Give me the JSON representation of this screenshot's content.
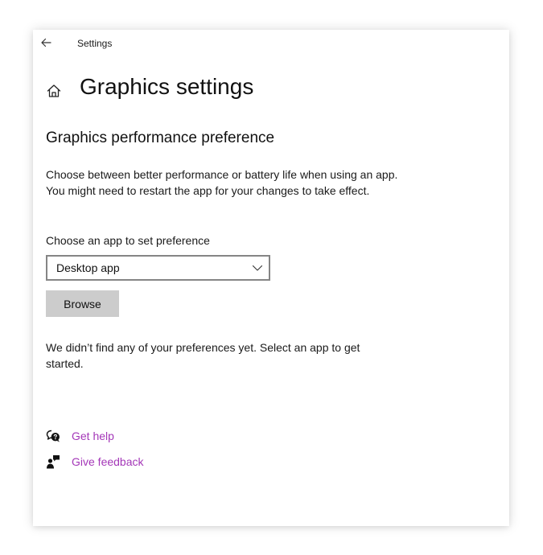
{
  "window": {
    "title": "Settings"
  },
  "header": {
    "page_title": "Graphics settings"
  },
  "section": {
    "title": "Graphics performance preference",
    "description": "Choose between better performance or battery life when using an app. You might need to restart the app for your changes to take effect."
  },
  "app_picker": {
    "label": "Choose an app to set preference",
    "selected": "Desktop app",
    "browse_label": "Browse"
  },
  "empty_message": "We didn’t find any of your preferences yet. Select an app to get started.",
  "links": {
    "help_label": "Get help",
    "feedback_label": "Give feedback"
  },
  "colors": {
    "link": "#a437b8",
    "button_bg": "#cccccc",
    "dropdown_border": "#858585"
  },
  "icons": {
    "back": "back-arrow-icon",
    "home": "home-icon",
    "dropdown": "chevron-down-icon",
    "help": "help-chat-icon",
    "feedback": "feedback-person-icon"
  }
}
